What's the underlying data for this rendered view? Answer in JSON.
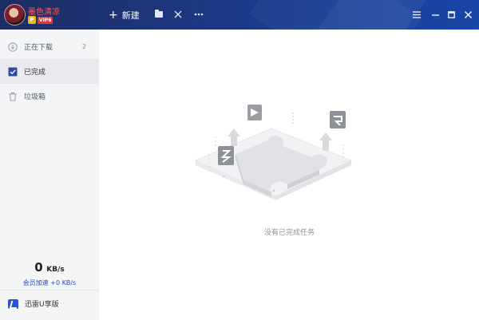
{
  "titlebar": {
    "username": "墨色清凉",
    "vip_label": "VIP6",
    "new_label": "新建",
    "icons": [
      "folder-icon",
      "clear-icon",
      "more-icon",
      "menu-icon",
      "minimize-icon",
      "maximize-icon",
      "close-icon"
    ]
  },
  "sidebar": {
    "items": [
      {
        "label": "正在下载",
        "count": "2",
        "icon": "download-icon",
        "active": false
      },
      {
        "label": "已完成",
        "count": "",
        "icon": "check-icon",
        "active": true
      },
      {
        "label": "垃圾箱",
        "count": "",
        "icon": "trash-icon",
        "active": false
      }
    ],
    "speed_value": "0",
    "speed_unit": "KB/s",
    "member_boost": "会员加速 +0 KB/s",
    "edition_label": "迅雷U享版"
  },
  "main": {
    "empty_message": "没有已完成任务"
  },
  "colors": {
    "titlebar": "#1c3a8a",
    "accent": "#2a4fc0",
    "username": "#ff5a5a",
    "sidebar_bg": "#f4f5f7"
  }
}
